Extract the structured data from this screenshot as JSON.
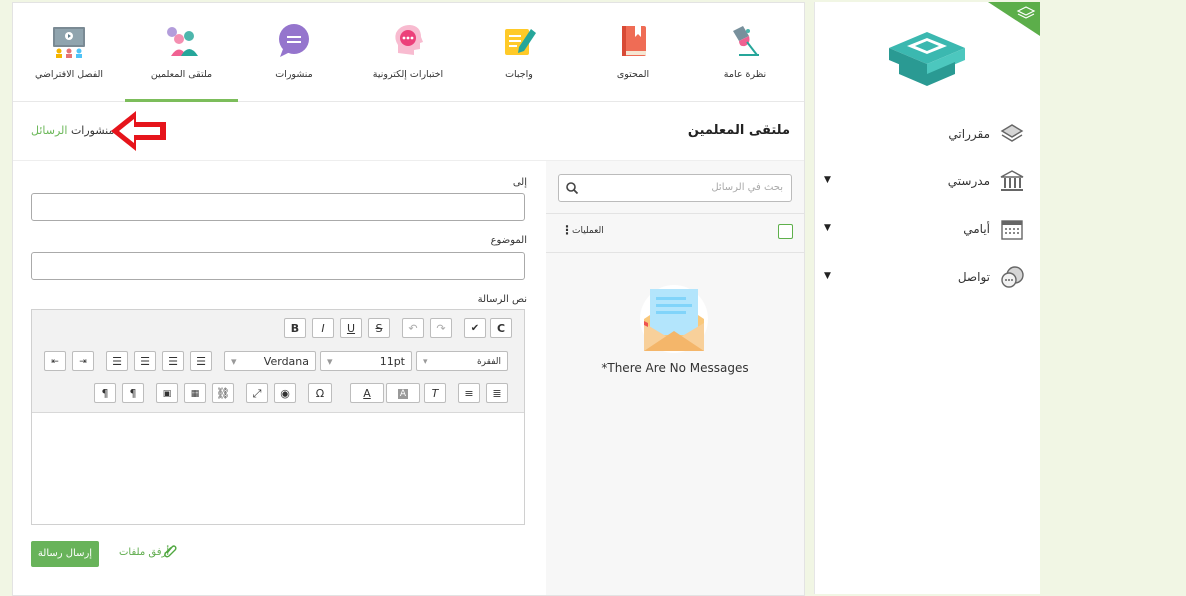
{
  "tabs": [
    {
      "label": "الفصل الافتراضي",
      "icon": "virtual-classroom-icon"
    },
    {
      "label": "ملتقى المعلمين",
      "icon": "teachers-forum-icon",
      "active": true
    },
    {
      "label": "منشورات",
      "icon": "posts-icon"
    },
    {
      "label": "اختبارات إلكترونية",
      "icon": "e-tests-icon"
    },
    {
      "label": "واجبات",
      "icon": "assignments-icon"
    },
    {
      "label": "المحتوى",
      "icon": "content-book-icon"
    },
    {
      "label": "نظرة عامة",
      "icon": "overview-lamp-icon"
    }
  ],
  "header": {
    "title": "ملتقى المعلمين",
    "crumb_posts": "منشورات",
    "crumb_messages": "الرسائل"
  },
  "messages": {
    "search_placeholder": "بحث في الرسائل",
    "operations_label": "العمليات",
    "empty_text": "*There Are No Messages"
  },
  "compose": {
    "to_label": "إلى",
    "subject_label": "الموضوع",
    "body_label": "نص الرسالة",
    "font_name": "Verdana",
    "font_size": "11pt",
    "paragraph": "الفقرة",
    "send_label": "إرسال رسالة",
    "attach_label": "أرفق ملفات"
  },
  "sidebar": {
    "items": [
      {
        "label": "مقرراتي",
        "icon": "layers-icon",
        "has_caret": false
      },
      {
        "label": "مدرستي",
        "icon": "school-building-icon",
        "has_caret": true
      },
      {
        "label": "أيامي",
        "icon": "calendar-icon",
        "has_caret": true
      },
      {
        "label": "تواصل",
        "icon": "chat-bubbles-icon",
        "has_caret": true
      }
    ]
  },
  "colors": {
    "accent": "#7cbd5b",
    "send_button": "#68b35a",
    "arrow": "#e6141b",
    "page_bg": "#f1f6e4",
    "logo_teal": "#3bb8b0"
  }
}
